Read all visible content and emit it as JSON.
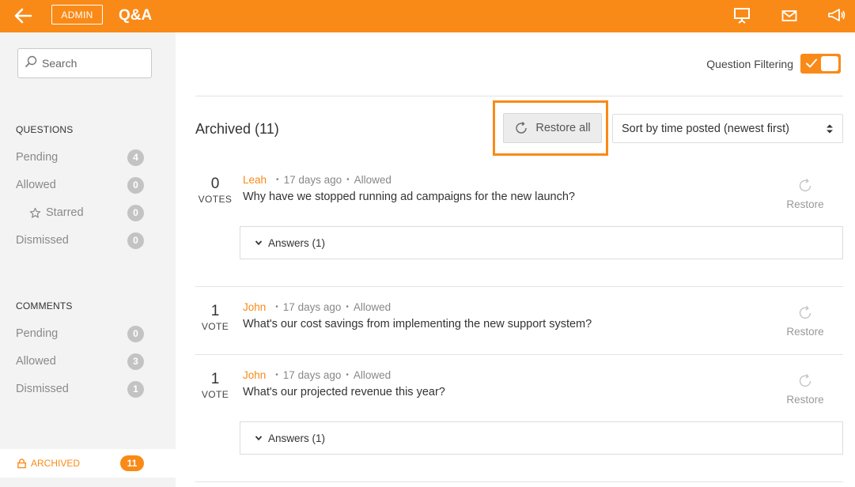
{
  "header": {
    "admin_label": "ADMIN",
    "title": "Q&A",
    "icons": [
      "back-arrow-icon",
      "presentation-icon",
      "envelope-icon",
      "megaphone-icon"
    ],
    "accent": "#fa8a17"
  },
  "sidebar": {
    "search_placeholder": "Search",
    "questions_heading": "QUESTIONS",
    "questions": [
      {
        "label": "Pending",
        "count": "4"
      },
      {
        "label": "Allowed",
        "count": "0"
      },
      {
        "label": "Starred",
        "count": "0"
      },
      {
        "label": "Dismissed",
        "count": "0"
      }
    ],
    "comments_heading": "COMMENTS",
    "comments": [
      {
        "label": "Pending",
        "count": "0"
      },
      {
        "label": "Allowed",
        "count": "3"
      },
      {
        "label": "Dismissed",
        "count": "1"
      }
    ],
    "archived": {
      "label": "ARCHIVED",
      "count": "11"
    }
  },
  "main": {
    "filter_label": "Question Filtering",
    "filter_enabled": true,
    "archived_title": "Archived (11)",
    "restore_all_label": "Restore all",
    "sort_value": "Sort by time posted (newest first)",
    "questions": [
      {
        "votes": "0",
        "votes_label": "VOTES",
        "author": "Leah",
        "time": "17 days ago",
        "status": "Allowed",
        "text": "Why have we stopped running ad campaigns for the new launch?",
        "restore_label": "Restore",
        "answers_label": "Answers (1)"
      },
      {
        "votes": "1",
        "votes_label": "VOTE",
        "author": "John",
        "time": "17 days ago",
        "status": "Allowed",
        "text": "What's our cost savings from implementing the new support system?",
        "restore_label": "Restore"
      },
      {
        "votes": "1",
        "votes_label": "VOTE",
        "author": "John",
        "time": "17 days ago",
        "status": "Allowed",
        "text": "What's our projected revenue this year?",
        "restore_label": "Restore",
        "answers_label": "Answers (1)"
      }
    ]
  }
}
